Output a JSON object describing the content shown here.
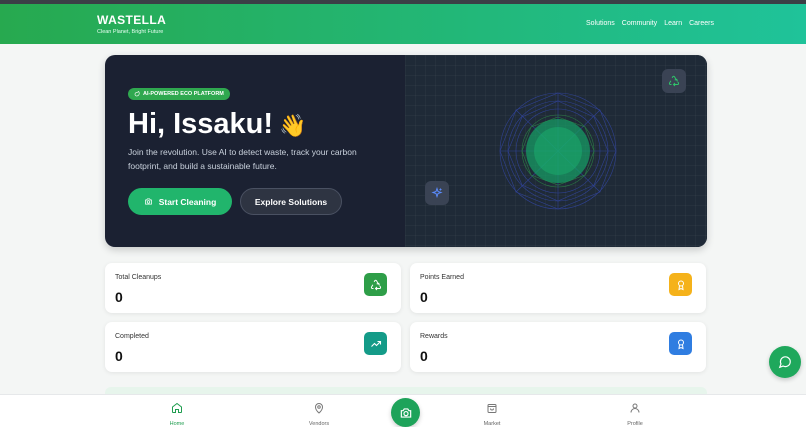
{
  "header": {
    "brand": "WASTELLA",
    "tagline": "Clean Planet, Bright Future",
    "nav": [
      "Solutions",
      "Community",
      "Learn",
      "Careers"
    ]
  },
  "hero": {
    "badge": "AI-POWERED ECO PLATFORM",
    "greeting": "Hi, Issaku!",
    "wave": "👋",
    "subtitle": "Join the revolution. Use AI to detect waste, track your carbon footprint, and build a sustainable future.",
    "start_button": "Start Cleaning",
    "explore_button": "Explore Solutions"
  },
  "stats": [
    {
      "label": "Total Cleanups",
      "value": "0",
      "icon": "recycle-icon",
      "color": "#2e9e48"
    },
    {
      "label": "Points Earned",
      "value": "0",
      "icon": "award-icon",
      "color": "#f5b21a"
    },
    {
      "label": "Completed",
      "value": "0",
      "icon": "trending-up-icon",
      "color": "#149b88"
    },
    {
      "label": "Rewards",
      "value": "0",
      "icon": "award-icon",
      "color": "#2f7de1"
    }
  ],
  "bottom_nav": {
    "home": "Home",
    "vendors": "Vendors",
    "market": "Market",
    "profile": "Profile"
  },
  "colors": {
    "accent": "#21b56c",
    "hero_bg": "#1b2132"
  }
}
